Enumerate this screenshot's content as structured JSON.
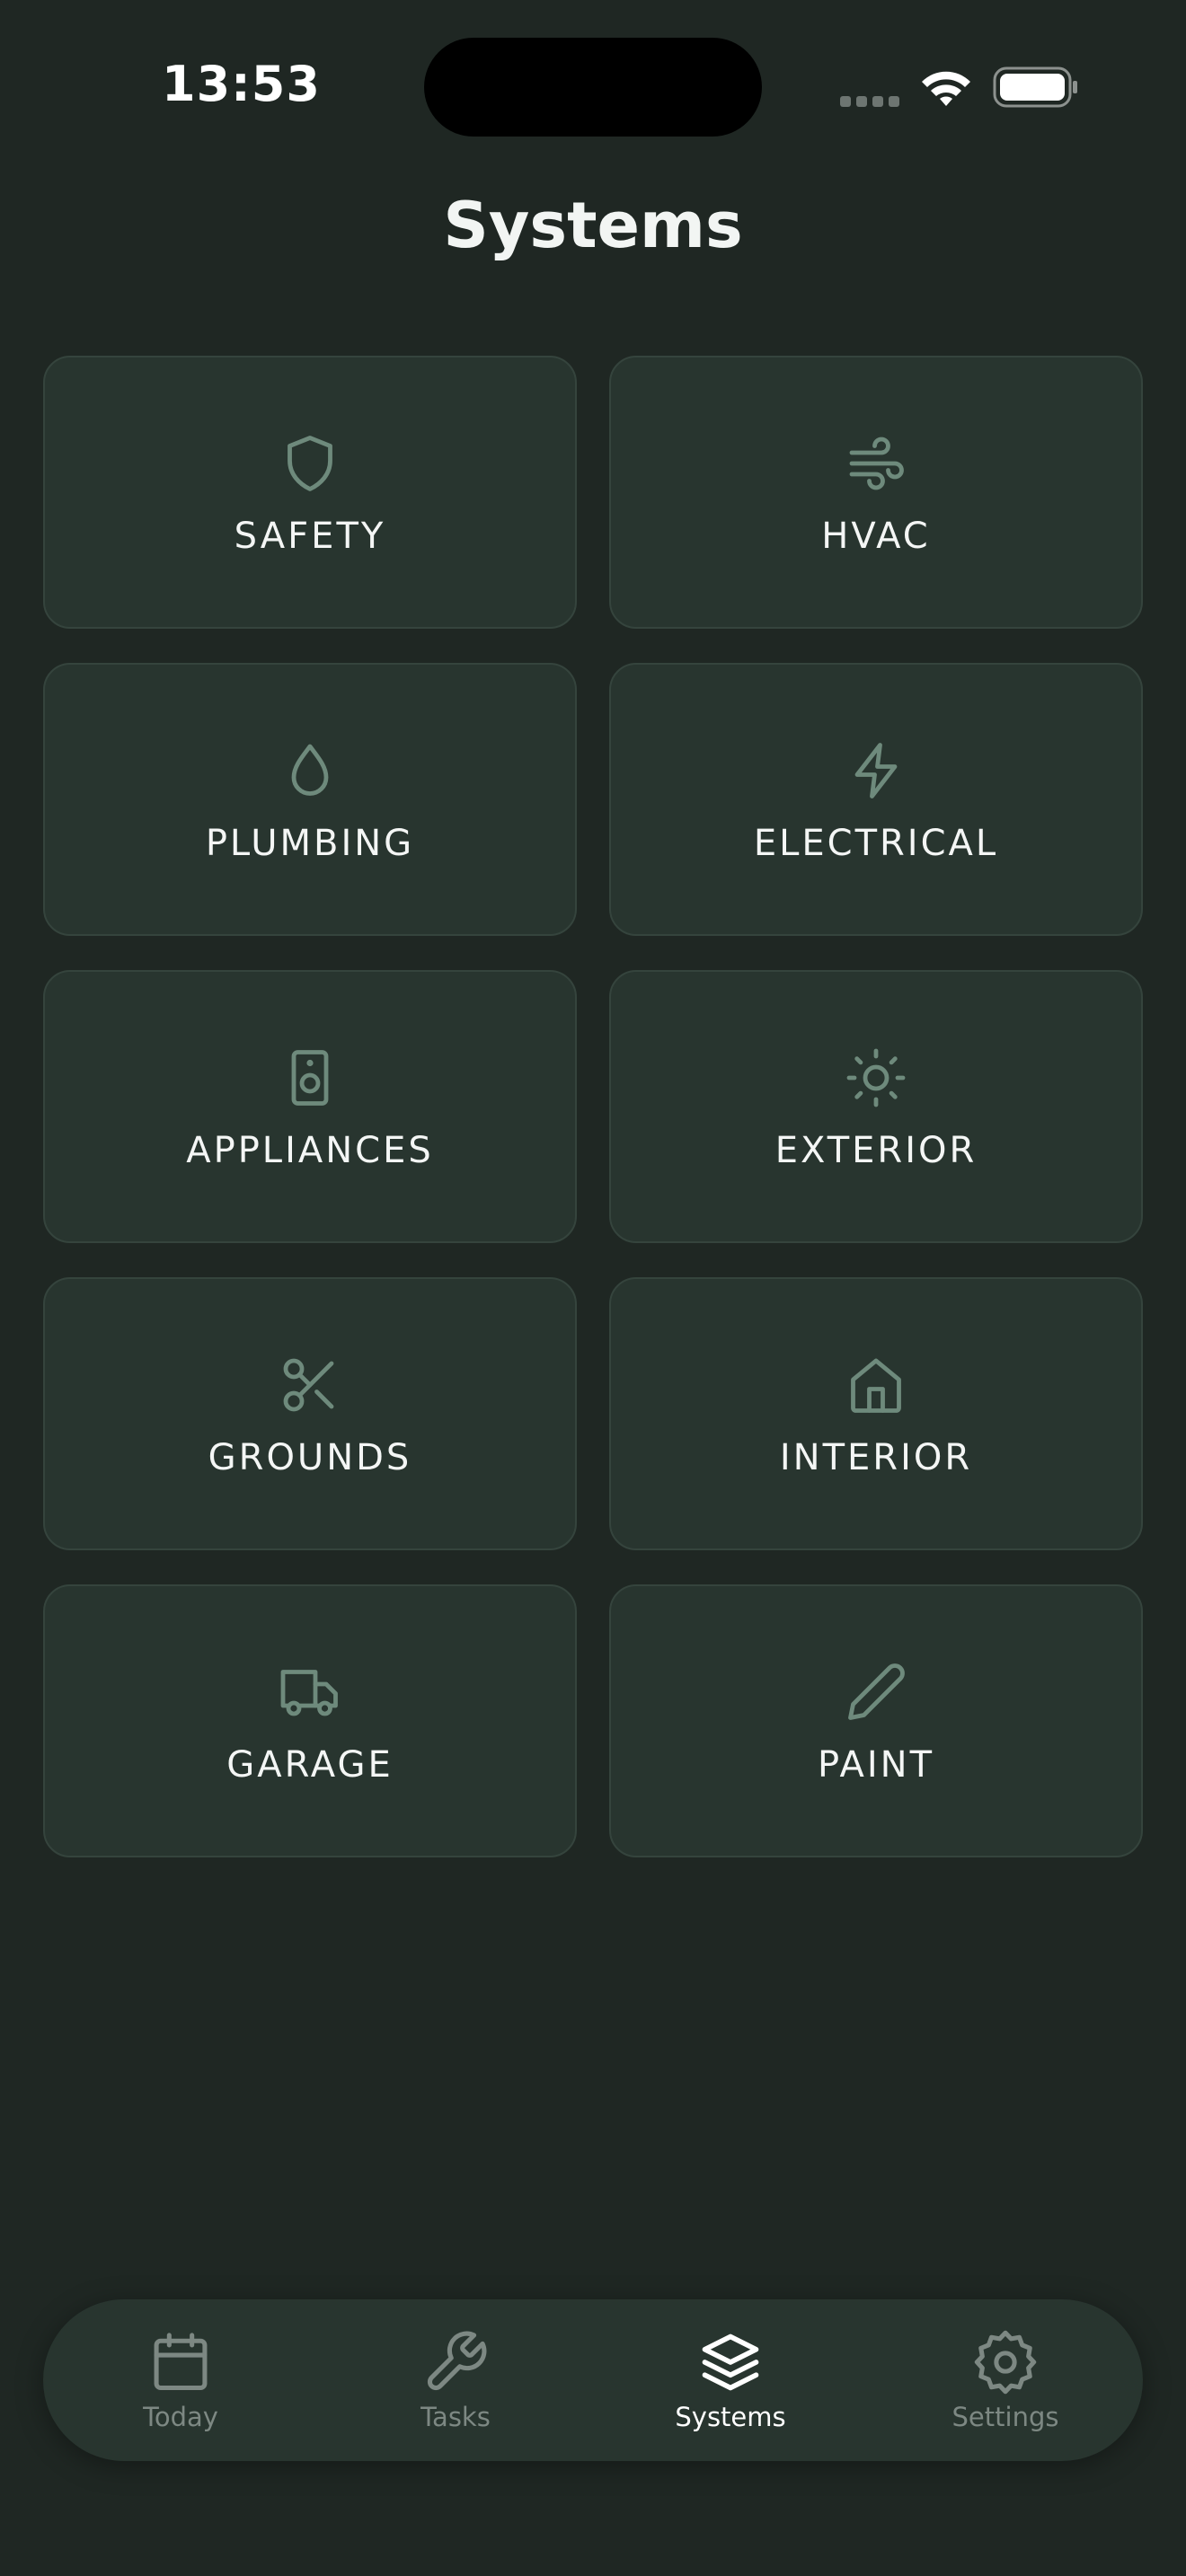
{
  "status_bar": {
    "time": "13:53"
  },
  "header": {
    "title": "Systems"
  },
  "systems": [
    {
      "label": "SAFETY",
      "icon": "shield-icon"
    },
    {
      "label": "HVAC",
      "icon": "wind-icon"
    },
    {
      "label": "PLUMBING",
      "icon": "water-drop-icon"
    },
    {
      "label": "ELECTRICAL",
      "icon": "lightning-icon"
    },
    {
      "label": "APPLIANCES",
      "icon": "speaker-icon"
    },
    {
      "label": "EXTERIOR",
      "icon": "sun-icon"
    },
    {
      "label": "GROUNDS",
      "icon": "scissors-icon"
    },
    {
      "label": "INTERIOR",
      "icon": "house-icon"
    },
    {
      "label": "GARAGE",
      "icon": "truck-icon"
    },
    {
      "label": "PAINT",
      "icon": "pencil-icon"
    }
  ],
  "tabbar": {
    "tabs": [
      {
        "label": "Today",
        "icon": "calendar-icon"
      },
      {
        "label": "Tasks",
        "icon": "wrench-icon"
      },
      {
        "label": "Systems",
        "icon": "layers-icon",
        "active": true
      },
      {
        "label": "Settings",
        "icon": "gear-icon"
      }
    ]
  },
  "colors": {
    "background": "#1f2723",
    "card": "#28352f",
    "icon": "#6e8a7c",
    "active_tab": "#ffffff",
    "inactive_tab": "#7d8883"
  }
}
